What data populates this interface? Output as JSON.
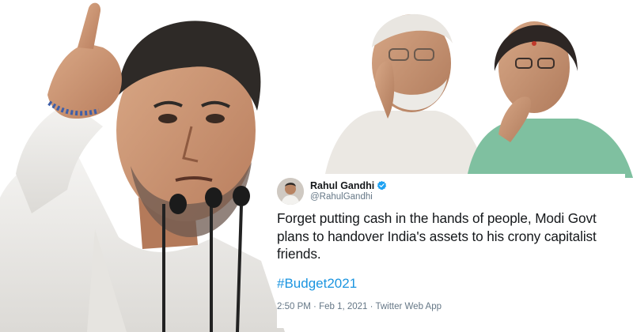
{
  "tweet": {
    "author_name": "Rahul Gandhi",
    "handle": "@RahulGandhi",
    "verified_color": "#1da1f2",
    "text": "Forget putting cash in the hands of people, Modi Govt plans to handover India's assets to his crony capitalist friends.",
    "hashtag": "#Budget2021",
    "time": "2:50 PM",
    "separator": " · ",
    "date": "Feb 1, 2021",
    "source": "Twitter Web App"
  },
  "colors": {
    "hashtag": "#1b95e0",
    "text": "#14171a",
    "muted": "#657786"
  }
}
